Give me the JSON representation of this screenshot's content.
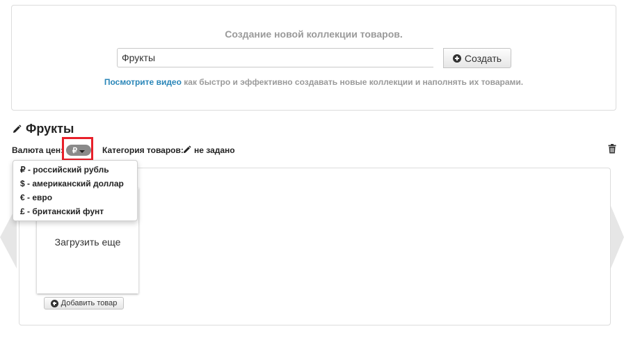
{
  "top_panel": {
    "title": "Создание новой коллекции товаров.",
    "input_value": "Фрукты",
    "create_label": "Создать",
    "hint_link": "Посмотрите видео",
    "hint_text": " как быстро и эффективно создавать новые коллекции и наполнять их товарами."
  },
  "collection": {
    "title": "Фрукты",
    "currency_label": "Валюта цен:",
    "currency_symbol": "₽",
    "category_label": "Категория товаров:",
    "category_value": "не задано"
  },
  "currency_menu": {
    "items": [
      {
        "symbol": "₽",
        "label": " - российский рубль"
      },
      {
        "symbol": "$",
        "label": " - американский доллар"
      },
      {
        "symbol": "€",
        "label": " - евро"
      },
      {
        "symbol": "£",
        "label": " - британский фунт"
      }
    ]
  },
  "items_panel": {
    "load_more": "Загрузить еще",
    "add_product": "Добавить товар"
  },
  "colors": {
    "link": "#2a86b8",
    "highlight": "#e8202a",
    "muted_text": "#9a9a9a"
  }
}
